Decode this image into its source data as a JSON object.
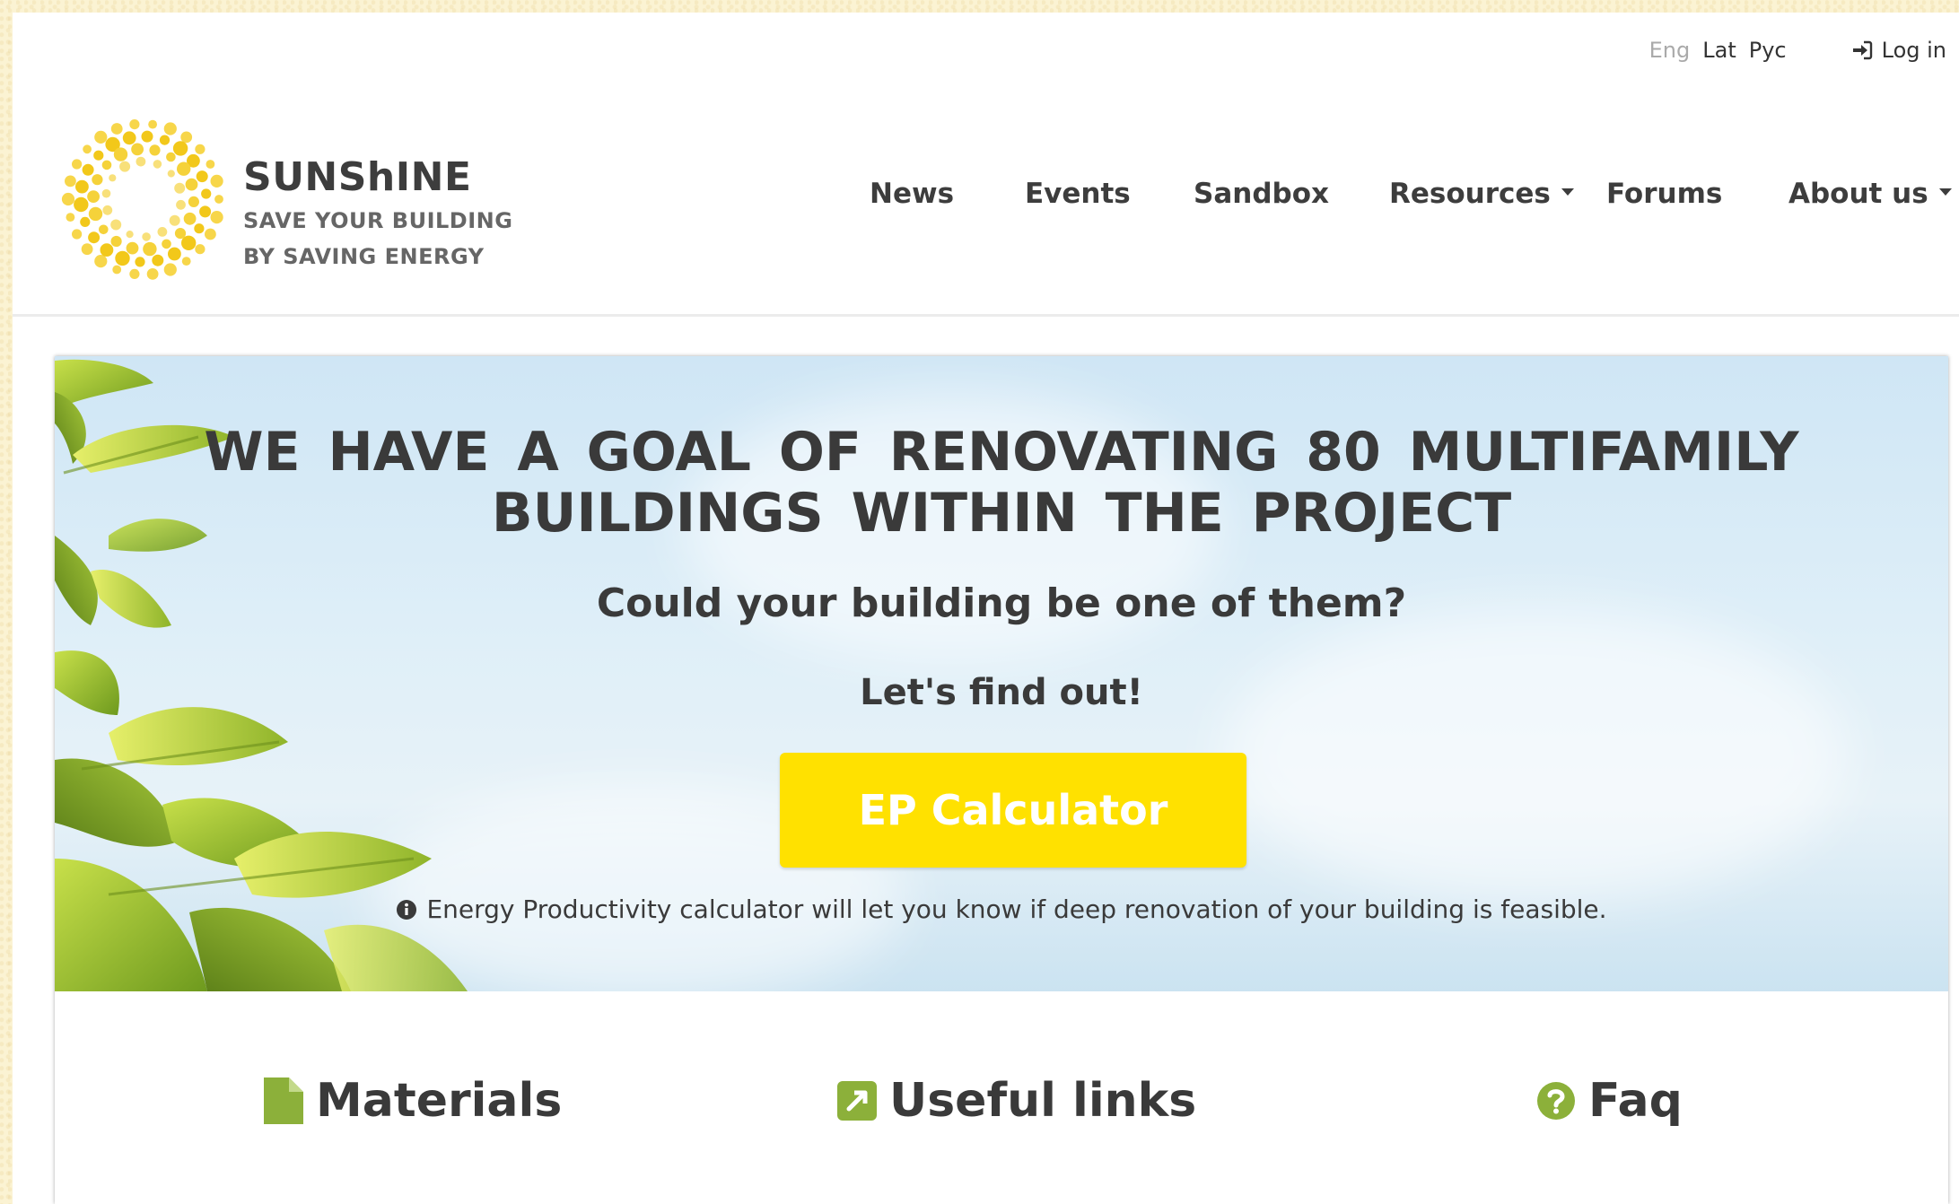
{
  "topbar": {
    "languages": [
      {
        "label": "Eng",
        "active": false
      },
      {
        "label": "Lat",
        "active": true
      },
      {
        "label": "Рус",
        "active": true
      }
    ],
    "login_label": "Log in"
  },
  "brand": {
    "name": "SUNShINE",
    "tagline_1": "SAVE YOUR BUILDING",
    "tagline_2": "BY SAVING ENERGY"
  },
  "nav": {
    "items": [
      {
        "label": "News",
        "dropdown": false
      },
      {
        "label": "Events",
        "dropdown": false
      },
      {
        "label": "Sandbox",
        "dropdown": false
      },
      {
        "label": "Resources",
        "dropdown": true
      },
      {
        "label": "Forums",
        "dropdown": false
      },
      {
        "label": "About us",
        "dropdown": true
      }
    ]
  },
  "hero": {
    "title_line_1": "WE HAVE A GOAL OF RENOVATING 80 MULTIFAMILY",
    "title_line_2": "BUILDINGS WITHIN THE PROJECT",
    "subtitle": "Could your building be one of them?",
    "find_out": "Let's find out!",
    "cta_label": "EP Calculator",
    "info_text": "Energy Productivity calculator will let you know if deep renovation of your building is feasible."
  },
  "quick_links": [
    {
      "label": "Materials",
      "icon": "file-icon"
    },
    {
      "label": "Useful links",
      "icon": "external-link-icon"
    },
    {
      "label": "Faq",
      "icon": "question-circle-icon"
    }
  ],
  "colors": {
    "accent_yellow": "#ffe100",
    "icon_green": "#8cb03a",
    "text_dark": "#3a3a3a",
    "page_background": "#fbf3d3"
  }
}
